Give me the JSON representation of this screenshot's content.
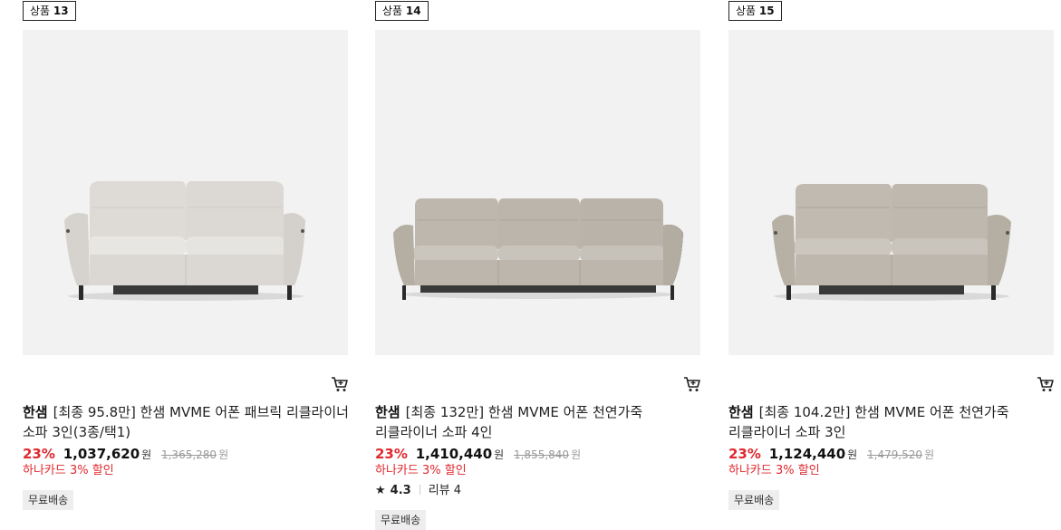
{
  "products": [
    {
      "badge_prefix": "상품",
      "badge_num": "13",
      "brand": "한샘",
      "title": "[최종 95.8만] 한샘 MVME 어폰 패브릭 리클라이너 소파 3인(3종/택1)",
      "discount_rate": "23%",
      "price": "1,037,620",
      "currency": "원",
      "original_price": "1,365,280",
      "card_discount": "하나카드 3% 할인",
      "shipping": "무료배송",
      "image": "fabric-recliner-sofa-2seat-light-gray"
    },
    {
      "badge_prefix": "상품",
      "badge_num": "14",
      "brand": "한샘",
      "title": "[최종 132만] 한샘 MVME 어폰 천연가죽 리클라이너 소파 4인",
      "discount_rate": "23%",
      "price": "1,410,440",
      "currency": "원",
      "original_price": "1,855,840",
      "card_discount": "하나카드 3% 할인",
      "rating_icon": "star-icon",
      "rating": "4.3",
      "review_label": "리뷰 4",
      "shipping": "무료배송",
      "image": "leather-recliner-sofa-3seat-taupe"
    },
    {
      "badge_prefix": "상품",
      "badge_num": "15",
      "brand": "한샘",
      "title": "[최종 104.2만] 한샘 MVME 어폰 천연가죽 리클라이너 소파 3인",
      "discount_rate": "23%",
      "price": "1,124,440",
      "currency": "원",
      "original_price": "1,479,520",
      "card_discount": "하나카드 3% 할인",
      "shipping": "무료배송",
      "image": "leather-recliner-sofa-2seat-taupe"
    }
  ],
  "icons": {
    "cart": "cart-icon",
    "star": "star-icon"
  },
  "colors": {
    "sale_red": "#e0282e",
    "image_bg": "#f2f2f2",
    "badge_border": "#222222",
    "ship_bg": "#eeeeee"
  }
}
